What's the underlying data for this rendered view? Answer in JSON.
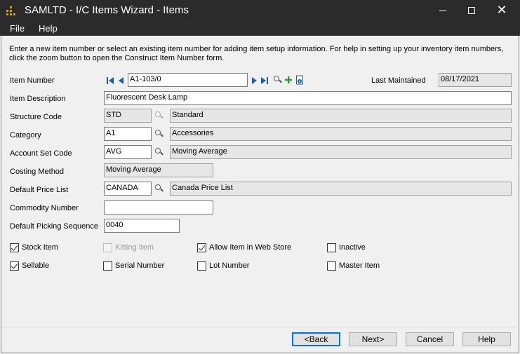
{
  "window": {
    "title": "SAMLTD - I/C Items Wizard - Items"
  },
  "menu": {
    "file": "File",
    "help": "Help"
  },
  "instructions": "Enter a new item number or select an existing item number for adding item setup information. For help in setting up your inventory item numbers, click the zoom button to open the Construct Item Number form.",
  "item_number": {
    "label": "Item Number",
    "value": "A1-103/0"
  },
  "last_maintained": {
    "label": "Last Maintained",
    "value": "08/17/2021"
  },
  "item_description": {
    "label": "Item Description",
    "value": "Fluorescent Desk Lamp"
  },
  "structure_code": {
    "label": "Structure Code",
    "code": "STD",
    "description": "Standard"
  },
  "category": {
    "label": "Category",
    "code": "A1",
    "description": "Accessories"
  },
  "account_set_code": {
    "label": "Account Set Code",
    "code": "AVG",
    "description": "Moving Average"
  },
  "costing_method": {
    "label": "Costing Method",
    "value": "Moving Average"
  },
  "default_price_list": {
    "label": "Default Price List",
    "code": "CANADA",
    "description": "Canada Price List"
  },
  "commodity_number": {
    "label": "Commodity Number",
    "value": ""
  },
  "default_picking_sequence": {
    "label": "Default Picking Sequence",
    "value": "0040"
  },
  "checkboxes": {
    "stock_item": {
      "label": "Stock Item",
      "checked": true
    },
    "kitting_item": {
      "label": "Kitting Item",
      "checked": false,
      "disabled": true
    },
    "allow_web_store": {
      "label": "Allow Item in Web Store",
      "checked": true
    },
    "inactive": {
      "label": "Inactive",
      "checked": false
    },
    "sellable": {
      "label": "Sellable",
      "checked": true
    },
    "serial_number": {
      "label": "Serial Number",
      "checked": false
    },
    "lot_number": {
      "label": "Lot Number",
      "checked": false
    },
    "master_item": {
      "label": "Master Item",
      "checked": false
    }
  },
  "buttons": {
    "back": "<Back",
    "next": "Next>",
    "cancel": "Cancel",
    "help": "Help"
  },
  "colors": {
    "titlebar": "#2b2b2b",
    "default_button_border": "#0078d7",
    "add_icon": "#2e9e2e",
    "nav_icon": "#1a5fa8"
  }
}
